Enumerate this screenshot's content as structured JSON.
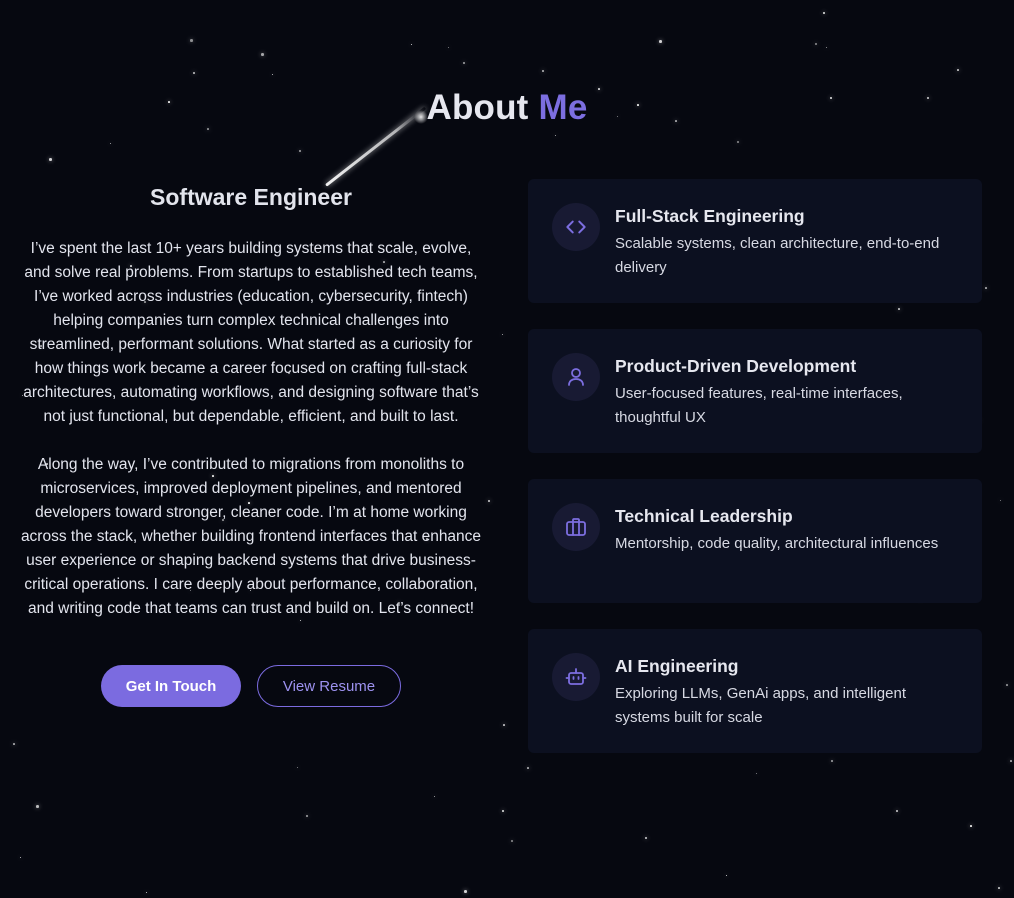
{
  "colors": {
    "background": "#060810",
    "accent": "#7b6be0",
    "card_bg": "#0c1020"
  },
  "section": {
    "title_main": "About",
    "title_accent": "Me"
  },
  "intro": {
    "role": "Software Engineer",
    "paragraphs": [
      "I’ve spent the last 10+ years building systems that scale, evolve, and solve real problems. From startups to established tech teams, I’ve worked across industries (education, cybersecurity, fintech) helping companies turn complex technical challenges into streamlined, performant solutions. What started as a curiosity for how things work became a career focused on crafting full-stack architectures, automating workflows, and designing software that’s not just functional, but dependable, efficient, and built to last.",
      "Along the way, I’ve contributed to migrations from monoliths to microservices, improved deployment pipelines, and mentored developers toward stronger, cleaner code. I’m at home working across the stack, whether building frontend interfaces that enhance user experience or shaping backend systems that drive business-critical operations. I care deeply about performance, collaboration, and writing code that teams can trust and build on. Let’s connect!"
    ],
    "primary_button": "Get In Touch",
    "secondary_button": "View Resume"
  },
  "cards": [
    {
      "icon": "code-icon",
      "title": "Full-Stack Engineering",
      "description": "Scalable systems, clean architecture, end-to-end delivery"
    },
    {
      "icon": "user-icon",
      "title": "Product-Driven Development",
      "description": "User-focused features, real-time interfaces, thoughtful UX"
    },
    {
      "icon": "briefcase-icon",
      "title": "Technical Leadership",
      "description": "Mentorship, code quality, architectural influences"
    },
    {
      "icon": "bot-icon",
      "title": "AI Engineering",
      "description": "Exploring LLMs, GenAi apps, and intelligent systems built for scale"
    }
  ]
}
